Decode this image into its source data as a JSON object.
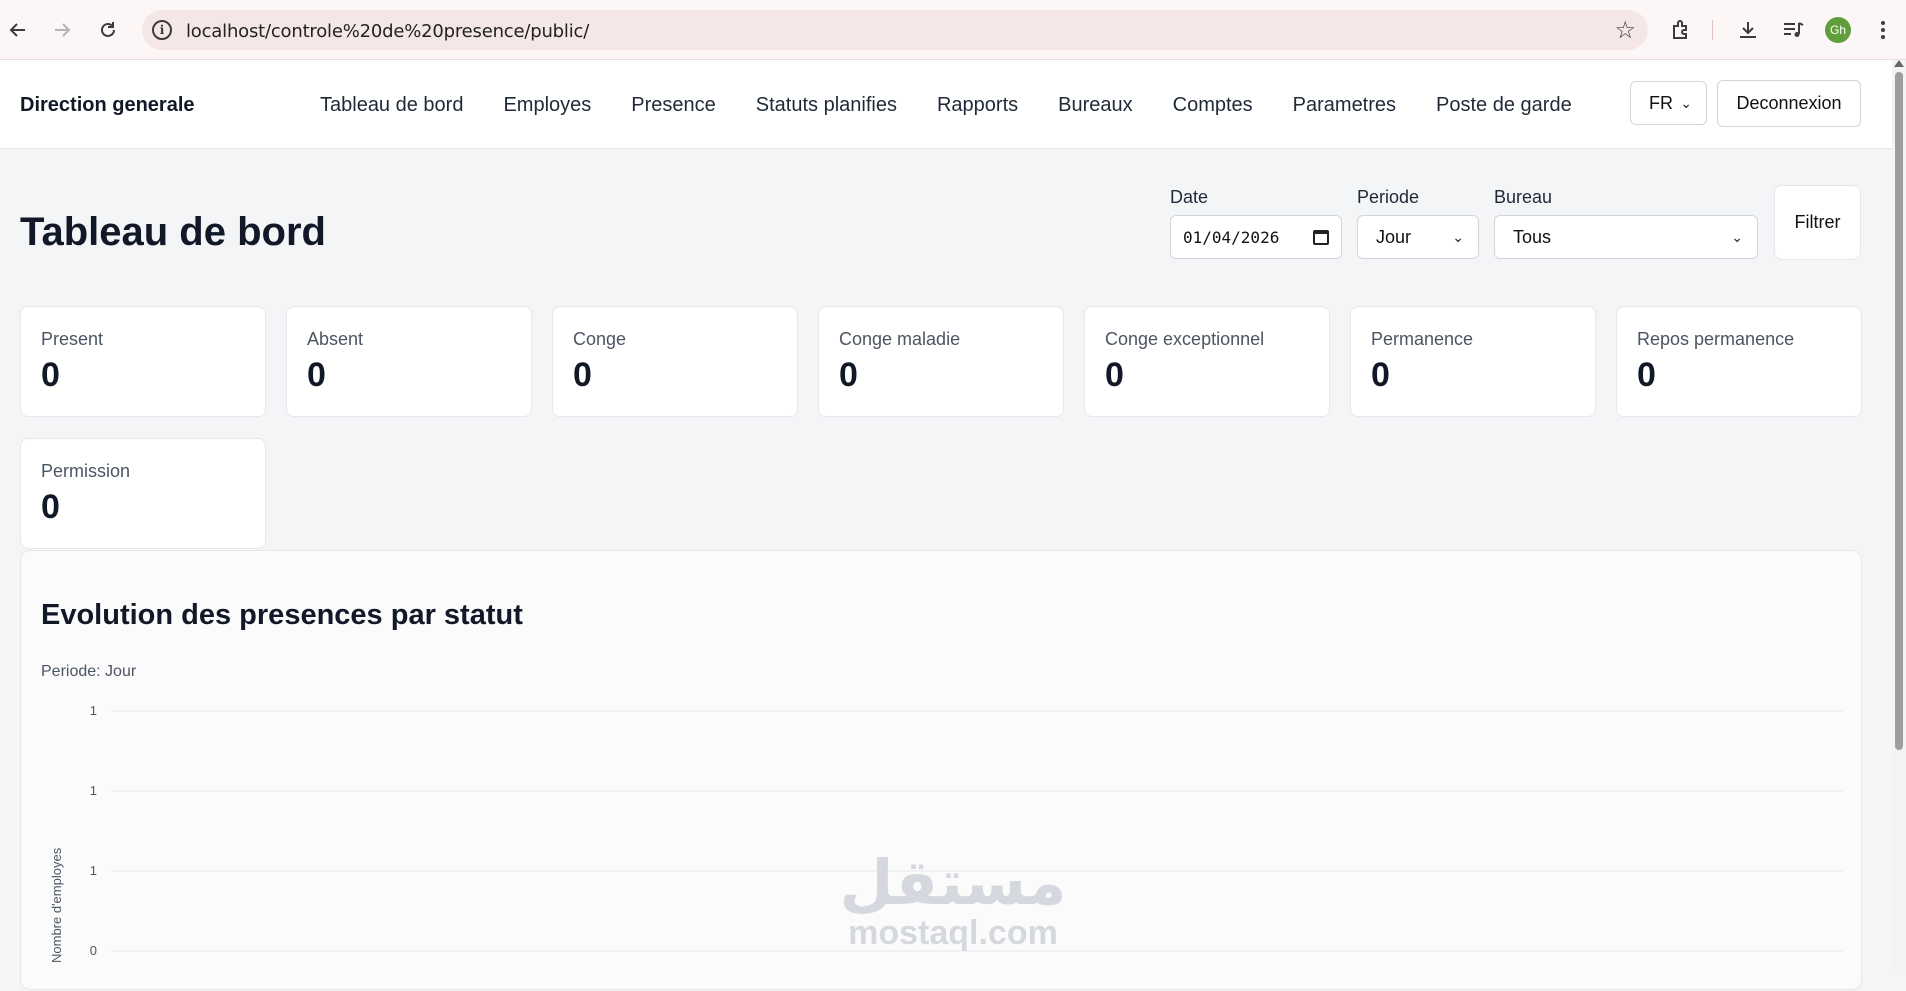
{
  "browser": {
    "url": "localhost/controle%20de%20presence/public/",
    "profile_initials": "Gh",
    "icons": [
      "back-icon",
      "forward-icon",
      "reload-icon",
      "info-icon",
      "star-icon",
      "extensions-icon",
      "download-icon",
      "media-icon",
      "menu-icon"
    ]
  },
  "nav": {
    "brand": "Direction generale",
    "items": [
      "Tableau de bord",
      "Employes",
      "Presence",
      "Statuts planifies",
      "Rapports",
      "Bureaux",
      "Comptes",
      "Parametres",
      "Poste de garde"
    ],
    "language": "FR",
    "logout_label": "Deconnexion"
  },
  "page": {
    "title": "Tableau de bord"
  },
  "filters": {
    "date_label": "Date",
    "date_value": "01/04/2026",
    "period_label": "Periode",
    "period_value": "Jour",
    "office_label": "Bureau",
    "office_value": "Tous",
    "submit_label": "Filtrer"
  },
  "stats": [
    {
      "label": "Present",
      "value": "0"
    },
    {
      "label": "Absent",
      "value": "0"
    },
    {
      "label": "Conge",
      "value": "0"
    },
    {
      "label": "Conge maladie",
      "value": "0"
    },
    {
      "label": "Conge exceptionnel",
      "value": "0"
    },
    {
      "label": "Permanence",
      "value": "0"
    },
    {
      "label": "Repos permanence",
      "value": "0"
    },
    {
      "label": "Permission",
      "value": "0"
    }
  ],
  "chart": {
    "title": "Evolution des presences par statut",
    "subtitle": "Periode: Jour"
  },
  "chart_data": {
    "type": "line",
    "title": "Evolution des presences par statut",
    "subtitle": "Periode: Jour",
    "ylabel": "Nombre d'employes",
    "xlabel": "",
    "y_ticks": [
      "1",
      "1",
      "1",
      "0"
    ],
    "grid": true,
    "series": []
  },
  "watermark": {
    "arabic": "مستقل",
    "latin": "mostaql.com"
  }
}
